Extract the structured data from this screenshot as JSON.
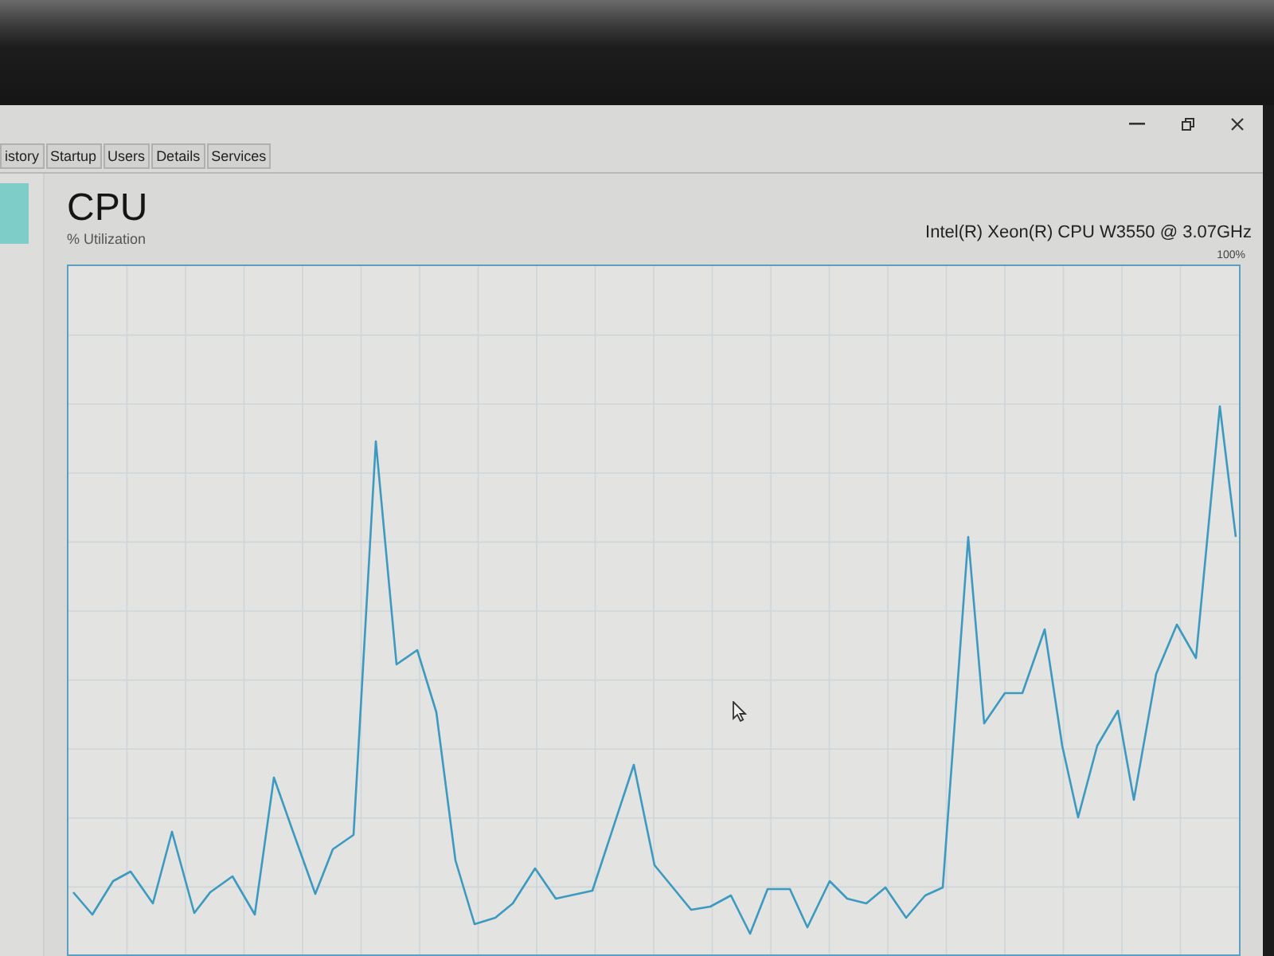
{
  "tabs": [
    {
      "label": "istory",
      "selected": false
    },
    {
      "label": "Startup",
      "selected": false
    },
    {
      "label": "Users",
      "selected": false
    },
    {
      "label": "Details",
      "selected": false
    },
    {
      "label": "Services",
      "selected": false
    }
  ],
  "sidebar": {
    "items": [
      {
        "selected": true
      }
    ]
  },
  "panel": {
    "title": "CPU",
    "subtitle": "% Utilization",
    "processor": "Intel(R) Xeon(R) CPU W3550 @ 3.07GHz",
    "graph": {
      "max_label": "100%"
    }
  }
}
